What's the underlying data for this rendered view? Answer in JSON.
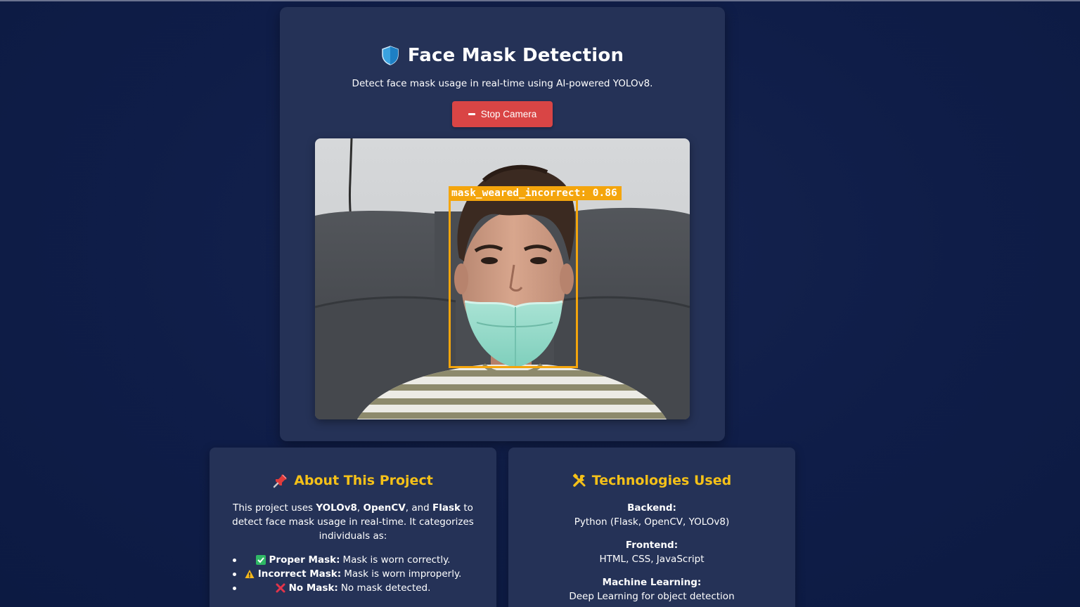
{
  "header": {
    "title": "Face Mask Detection",
    "subtitle": "Detect face mask usage in real-time using AI-powered YOLOv8.",
    "title_icon": "shield-icon"
  },
  "controls": {
    "stop_label": "Stop Camera"
  },
  "camera": {
    "detection_label": "mask_weared_incorrect: 0.86",
    "detection_color": "#f4a50c"
  },
  "about": {
    "title": "About This Project",
    "title_icon": "pushpin-icon",
    "intro_prefix": "This project uses ",
    "tech1": "YOLOv8",
    "sep1": ", ",
    "tech2": "OpenCV",
    "sep2": ", and ",
    "tech3": "Flask",
    "intro_suffix": " to detect face mask usage in real-time. It categorizes individuals as:",
    "items": [
      {
        "label": "Proper Mask:",
        "text": "Mask is worn correctly.",
        "icon": "check-mark-icon"
      },
      {
        "label": "Incorrect Mask:",
        "text": "Mask is worn improperly.",
        "icon": "warning-icon"
      },
      {
        "label": "No Mask:",
        "text": "No mask detected.",
        "icon": "cross-mark-icon"
      }
    ]
  },
  "tech": {
    "title": "Technologies Used",
    "title_icon": "tools-icon",
    "items": [
      {
        "heading": "Backend:",
        "value": "Python (Flask, OpenCV, YOLOv8)"
      },
      {
        "heading": "Frontend:",
        "value": "HTML, CSS, JavaScript"
      },
      {
        "heading": "Machine Learning:",
        "value": "Deep Learning for object detection"
      }
    ]
  },
  "colors": {
    "background": "#0f1d48",
    "card": "#253257",
    "accent_yellow": "#f5c118",
    "stop_button": "#d94545"
  }
}
